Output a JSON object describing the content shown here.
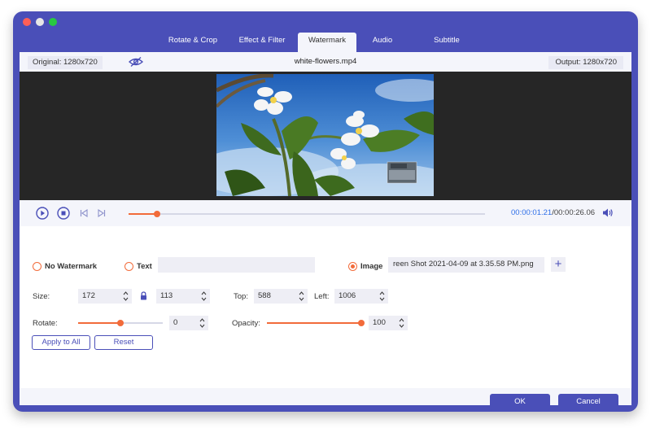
{
  "tabs": [
    {
      "label": "Rotate & Crop"
    },
    {
      "label": "Effect & Filter"
    },
    {
      "label": "Watermark",
      "active": true
    },
    {
      "label": "Audio"
    },
    {
      "label": "Subtitle"
    }
  ],
  "infobar": {
    "original": "Original: 1280x720",
    "filename": "white-flowers.mp4",
    "output": "Output: 1280x720"
  },
  "playback": {
    "current_time": "00:00:01.21",
    "separator": "/",
    "total_time": "00:00:26.06",
    "progress": 0.08
  },
  "watermark": {
    "no_watermark_label": "No Watermark",
    "text_label": "Text",
    "text_value": "",
    "image_label": "Image",
    "image_file": "reen Shot 2021-04-09 at 3.35.58 PM.png",
    "selected": "image",
    "size_label": "Size:",
    "width": "172",
    "height": "113",
    "top_label": "Top:",
    "top": "588",
    "left_label": "Left:",
    "left": "1006",
    "rotate_label": "Rotate:",
    "rotate": "0",
    "rotate_slider": 0.5,
    "opacity_label": "Opacity:",
    "opacity": "100",
    "opacity_slider": 1.0,
    "apply_all_label": "Apply to All",
    "reset_label": "Reset"
  },
  "footer": {
    "ok_label": "OK",
    "cancel_label": "Cancel"
  },
  "colors": {
    "accent": "#4a4fb8",
    "orange": "#f26b3a",
    "time_blue": "#2f6fe8"
  }
}
